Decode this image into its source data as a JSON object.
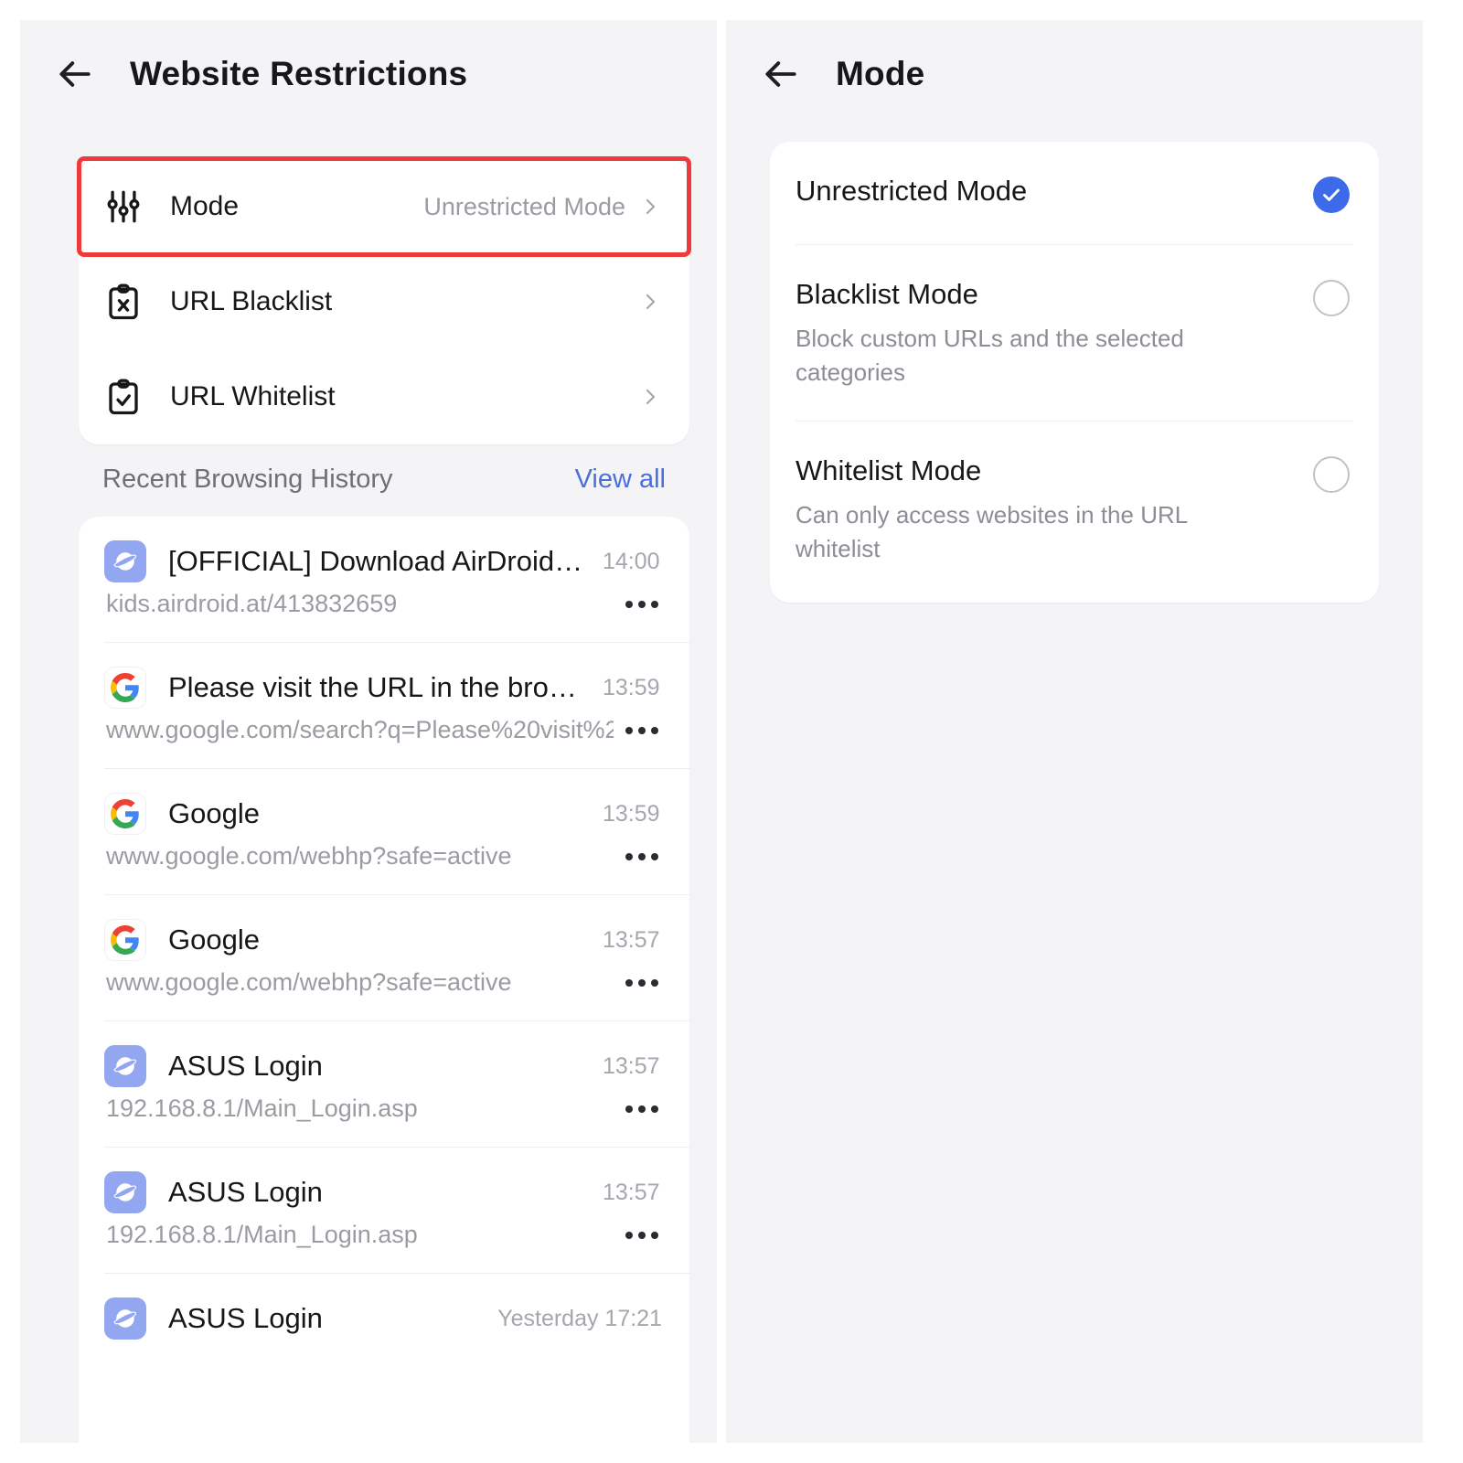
{
  "left_panel": {
    "header": {
      "title": "Website Restrictions",
      "back_icon": "arrow-left-icon"
    },
    "settings": [
      {
        "icon": "sliders-icon",
        "label": "Mode",
        "value": "Unrestricted Mode",
        "chevron": "chevron-right-icon",
        "highlighted": true
      },
      {
        "icon": "clipboard-x-icon",
        "label": "URL Blacklist",
        "value": "",
        "chevron": "chevron-right-icon",
        "highlighted": false
      },
      {
        "icon": "clipboard-check-icon",
        "label": "URL Whitelist",
        "value": "",
        "chevron": "chevron-right-icon",
        "highlighted": false
      }
    ],
    "history_section": {
      "heading": "Recent Browsing History",
      "view_all": "View all",
      "more_icon": "more-horizontal-icon"
    },
    "history": [
      {
        "favicon": "airdroid-globe-icon",
        "title": "[OFFICIAL] Download AirDroid…",
        "time": "14:00",
        "url": "kids.airdroid.at/413832659"
      },
      {
        "favicon": "google-icon",
        "title": "Please visit the URL in the bro…",
        "time": "13:59",
        "url": "www.google.com/search?q=Please%20visit%2…"
      },
      {
        "favicon": "google-icon",
        "title": "Google",
        "time": "13:59",
        "url": "www.google.com/webhp?safe=active"
      },
      {
        "favicon": "google-icon",
        "title": "Google",
        "time": "13:57",
        "url": "www.google.com/webhp?safe=active"
      },
      {
        "favicon": "airdroid-globe-icon",
        "title": "ASUS Login",
        "time": "13:57",
        "url": "192.168.8.1/Main_Login.asp"
      },
      {
        "favicon": "airdroid-globe-icon",
        "title": "ASUS Login",
        "time": "13:57",
        "url": "192.168.8.1/Main_Login.asp"
      },
      {
        "favicon": "airdroid-globe-icon",
        "title": "ASUS Login",
        "time": "Yesterday 17:21",
        "url": ""
      }
    ]
  },
  "right_panel": {
    "header": {
      "title": "Mode",
      "back_icon": "arrow-left-icon"
    },
    "options": [
      {
        "title": "Unrestricted Mode",
        "description": "",
        "selected": true
      },
      {
        "title": "Blacklist Mode",
        "description": "Block custom URLs and the selected categories",
        "selected": false
      },
      {
        "title": "Whitelist Mode",
        "description": "Can only access websites in the URL whitelist",
        "selected": false
      }
    ]
  },
  "colors": {
    "page_background": "#ffffff",
    "panel_background": "#f4f4f6",
    "card_background": "#ffffff",
    "accent_blue": "#3c6ae8",
    "link_blue": "#4a6fd8",
    "highlight_red": "#ee3a3a",
    "text_primary": "#17171a",
    "text_secondary": "#9b9ba3"
  }
}
